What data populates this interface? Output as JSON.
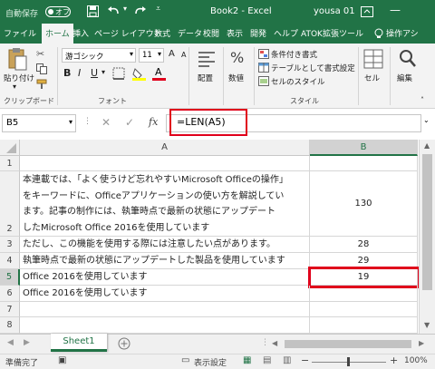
{
  "title_bar": {
    "autosave_label": "自動保存",
    "autosave_state": "オフ",
    "document_name": "Book2 - Excel",
    "user": "yousa 01"
  },
  "ribbon_tabs": [
    "ファイル",
    "ホーム",
    "挿入",
    "ページ レイアウト",
    "数式",
    "データ",
    "校閲",
    "表示",
    "開発",
    "ヘルプ",
    "ATOK拡張ツール"
  ],
  "active_tab": "ホーム",
  "search_label": "操作アシ",
  "ribbon": {
    "clipboard": {
      "paste_label": "貼り付け",
      "group_label": "クリップボード"
    },
    "font": {
      "font_name": "游ゴシック",
      "font_size": "11",
      "bold": "B",
      "italic": "I",
      "underline": "U",
      "grow": "A",
      "shrink": "A",
      "font_color_letter": "A",
      "group_label": "フォント"
    },
    "alignment": {
      "label": "配置"
    },
    "number": {
      "label": "数値",
      "symbol": "%"
    },
    "styles": {
      "conditional": "条件付き書式",
      "table": "テーブルとして書式設定",
      "cell_style": "セルのスタイル",
      "group_label": "スタイル"
    },
    "cells": {
      "label": "セル"
    },
    "editing": {
      "label": "編集"
    }
  },
  "formula_bar": {
    "name_box": "B5",
    "fx_label": "fx",
    "formula": "=LEN(A5)"
  },
  "grid": {
    "columns": [
      "A",
      "B"
    ],
    "rows": [
      {
        "num": "1",
        "a_lines": [],
        "b": ""
      },
      {
        "num": "2",
        "a_lines": [
          "本連載では、「よく使うけど忘れやすいMicrosoft Officeの操作」",
          "をキーワードに、Officeアプリケーションの使い方を解説してい",
          "ます。記事の制作には、執筆時点で最新の状態にアップデート",
          "したMicrosoft Office 2016を使用しています"
        ],
        "b": "130"
      },
      {
        "num": "3",
        "a_lines": [
          "ただし、この機能を使用する際には注意したい点があります。"
        ],
        "b": "28"
      },
      {
        "num": "4",
        "a_lines": [
          "執筆時点で最新の状態にアップデートした製品を使用しています"
        ],
        "b": "29"
      },
      {
        "num": "5",
        "a_lines": [
          "Office 2016を使用しています"
        ],
        "b": "19"
      },
      {
        "num": "6",
        "a_lines": [
          "Office 2016を使用しています"
        ],
        "b": ""
      },
      {
        "num": "7",
        "a_lines": [],
        "b": ""
      },
      {
        "num": "8",
        "a_lines": [],
        "b": ""
      },
      {
        "num": "9",
        "a_lines": [],
        "b": ""
      }
    ]
  },
  "sheet_tab": "Sheet1",
  "status_bar": {
    "ready": "準備完了",
    "display_settings": "表示設定",
    "zoom": "100%",
    "minus": "−",
    "plus": "+"
  },
  "colors": {
    "excel_green": "#217346",
    "highlight_red": "#e0001b",
    "ribbon_bg": "#f3f3f3"
  }
}
